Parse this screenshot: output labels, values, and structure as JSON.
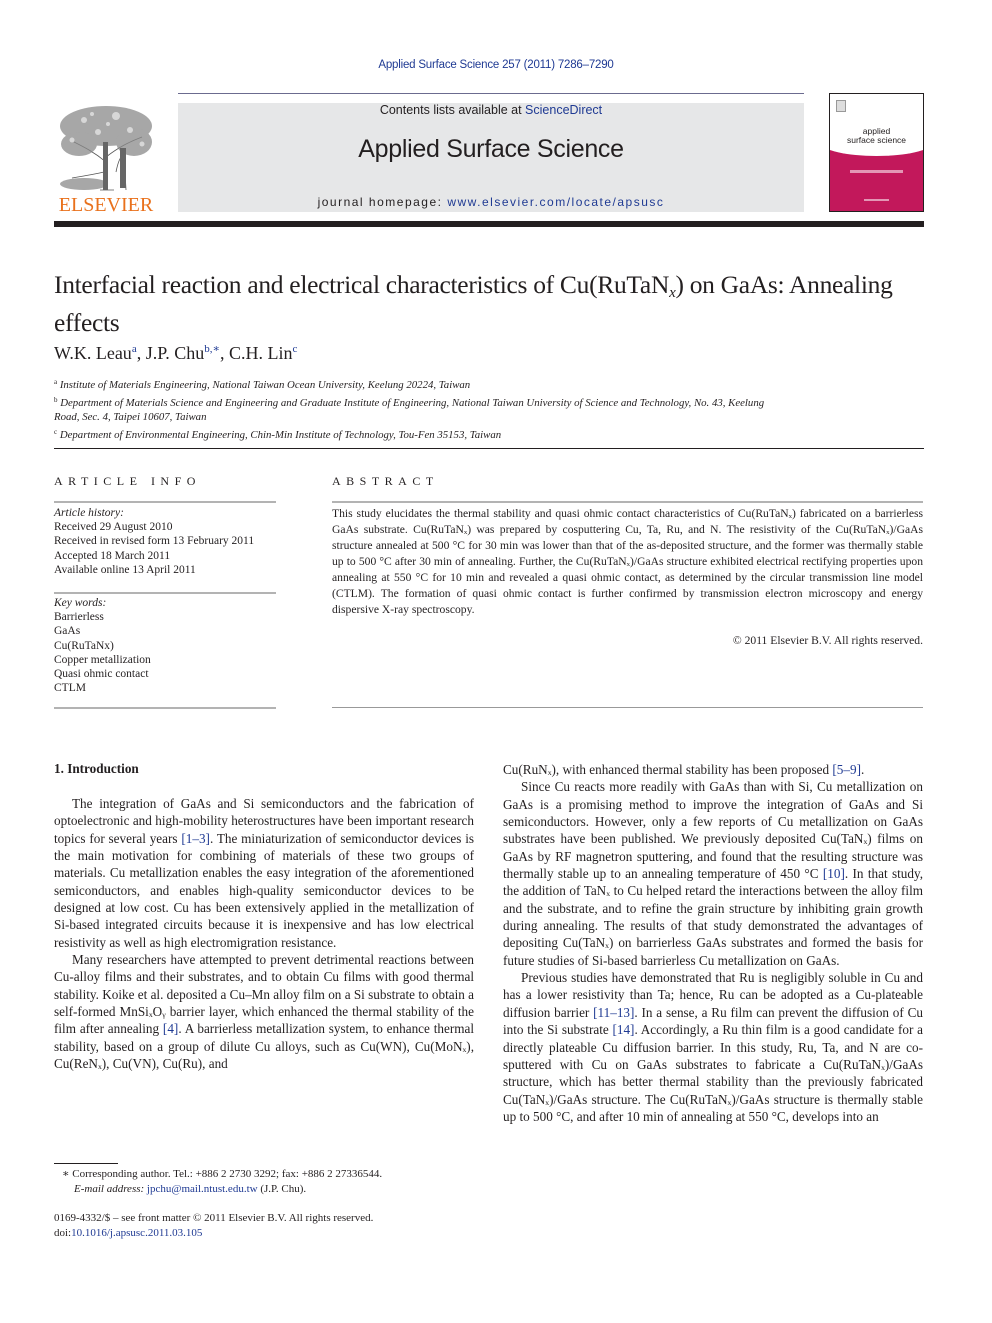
{
  "running_head": "Applied Surface Science 257 (2011) 7286–7290",
  "masthead": {
    "publisher_logo_text": "ELSEVIER",
    "contents_prefix": "Contents lists available at ",
    "contents_link": "ScienceDirect",
    "journal_title": "Applied Surface Science",
    "homepage_prefix": "journal homepage: ",
    "homepage_link": "www.elsevier.com/locate/apsusc",
    "cover_title_line1": "applied",
    "cover_title_line2": "surface science",
    "colors": {
      "elsevier_orange": "#e9711c",
      "link_blue": "#1f3a93",
      "cover_magenta": "#c2185b",
      "banner_gray": "#e6e7e8"
    }
  },
  "article": {
    "title_pre": "Interfacial reaction and electrical characteristics of Cu(RuTaN",
    "title_sub": "x",
    "title_post": ") on GaAs: Annealing effects",
    "authors": [
      {
        "name": "W.K. Leau",
        "aff": "a",
        "sep": ", "
      },
      {
        "name": "J.P. Chu",
        "aff": "b,∗",
        "sep": ", "
      },
      {
        "name": "C.H. Lin",
        "aff": "c",
        "sep": ""
      }
    ],
    "affiliations": [
      {
        "key": "a",
        "text": "Institute of Materials Engineering, National Taiwan Ocean University, Keelung 20224, Taiwan"
      },
      {
        "key": "b",
        "text": "Department of Materials Science and Engineering and Graduate Institute of Engineering, National Taiwan University of Science and Technology, No. 43, Keelung Road, Sec. 4, Taipei 10607, Taiwan"
      },
      {
        "key": "c",
        "text": "Department of Environmental Engineering, Chin-Min Institute of Technology, Tou-Fen 35153, Taiwan"
      }
    ]
  },
  "article_info": {
    "heading": "ARTICLE INFO",
    "history_label": "Article history:",
    "history": [
      "Received 29 August 2010",
      "Received in revised form 13 February 2011",
      "Accepted 18 March 2011",
      "Available online 13 April 2011"
    ],
    "keywords_label": "Key words:",
    "keywords": [
      "Barrierless",
      "GaAs",
      "Cu(RuTaNx)",
      "Copper metallization",
      "Quasi ohmic contact",
      "CTLM"
    ]
  },
  "abstract": {
    "heading": "ABSTRACT",
    "text": "This study elucidates the thermal stability and quasi ohmic contact characteristics of Cu(RuTaNₓ) fabricated on a barrierless GaAs substrate. Cu(RuTaNₓ) was prepared by cosputtering Cu, Ta, Ru, and N. The resistivity of the Cu(RuTaNₓ)/GaAs structure annealed at 500 °C for 30 min was lower than that of the as-deposited structure, and the former was thermally stable up to 500 °C after 30 min of annealing. Further, the Cu(RuTaNₓ)/GaAs structure exhibited electrical rectifying properties upon annealing at 550 °C for 10 min and revealed a quasi ohmic contact, as determined by the circular transmission line model (CTLM). The formation of quasi ohmic contact is further confirmed by transmission electron microscopy and energy dispersive X-ray spectroscopy.",
    "copyright": "© 2011 Elsevier B.V. All rights reserved."
  },
  "introduction": {
    "heading": "1.  Introduction",
    "p1_a": "The integration of GaAs and Si semiconductors and the fabrication of optoelectronic and high-mobility heterostructures have been important research topics for several years ",
    "p1_ref": "[1–3]",
    "p1_b": ". The miniaturization of semiconductor devices is the main motivation for combining of materials of these two groups of materials. Cu metallization enables the easy integration of the aforementioned semiconductors, and enables high-quality semiconductor devices to be designed at low cost. Cu has been extensively applied in the metallization of Si-based integrated circuits because it is inexpensive and has low electrical resistivity as well as high electromigration resistance.",
    "p2_a": "Many researchers have attempted to prevent detrimental reactions between Cu-alloy films and their substrates, and to obtain Cu films with good thermal stability. Koike et al. deposited a Cu–Mn alloy film on a Si substrate to obtain a self-formed MnSiₓOᵧ barrier layer, which enhanced the thermal stability of the film after annealing ",
    "p2_ref": "[4]",
    "p2_b": ". A barrierless metallization system, to enhance thermal stability, based on a group of dilute Cu alloys, such as Cu(WN), Cu(MoNₓ), Cu(ReNₓ), Cu(VN), Cu(Ru), and",
    "p2_c": "Cu(RuNₓ), with enhanced thermal stability has been proposed ",
    "p2_ref2": "[5–9]",
    "p2_d": ".",
    "p3_a": "Since Cu reacts more readily with GaAs than with Si, Cu metallization on GaAs is a promising method to improve the integration of GaAs and Si semiconductors. However, only a few reports of Cu metallization on GaAs substrates have been published. We previously deposited Cu(TaNₓ) films on GaAs by RF magnetron sputtering, and found that the resulting structure was thermally stable up to an annealing temperature of 450 °C ",
    "p3_ref": "[10]",
    "p3_b": ". In that study, the addition of TaNₓ to Cu helped retard the interactions between the alloy film and the substrate, and to refine the grain structure by inhibiting grain growth during annealing. The results of that study demonstrated the advantages of depositing Cu(TaNₓ) on barrierless GaAs substrates and formed the basis for future studies of Si-based barrierless Cu metallization on GaAs.",
    "p4_a": "Previous studies have demonstrated that Ru is negligibly soluble in Cu and has a lower resistivity than Ta; hence, Ru can be adopted as a Cu-plateable diffusion barrier ",
    "p4_ref1": "[11–13]",
    "p4_b": ". In a sense, a Ru film can prevent the diffusion of Cu into the Si substrate ",
    "p4_ref2": "[14]",
    "p4_c": ". Accordingly, a Ru thin film is a good candidate for a directly plateable Cu diffusion barrier. In this study, Ru, Ta, and N are co-sputtered with Cu on GaAs substrates to fabricate a Cu(RuTaNₓ)/GaAs structure, which has better thermal stability than the previously fabricated Cu(TaNₓ)/GaAs structure. The Cu(RuTaNₓ)/GaAs structure is thermally stable up to 500 °C, and after 10 min of annealing at 550 °C, develops into an"
  },
  "footnotes": {
    "corresponding": "∗ Corresponding author. Tel.: +886 2 2730 3292; fax: +886 2 27336544.",
    "email_label": "E-mail address: ",
    "email": "jpchu@mail.ntust.edu.tw",
    "email_suffix": " (J.P. Chu).",
    "front_matter": "0169-4332/$ – see front matter © 2011 Elsevier B.V. All rights reserved.",
    "doi_label": "doi:",
    "doi": "10.1016/j.apsusc.2011.03.105"
  }
}
